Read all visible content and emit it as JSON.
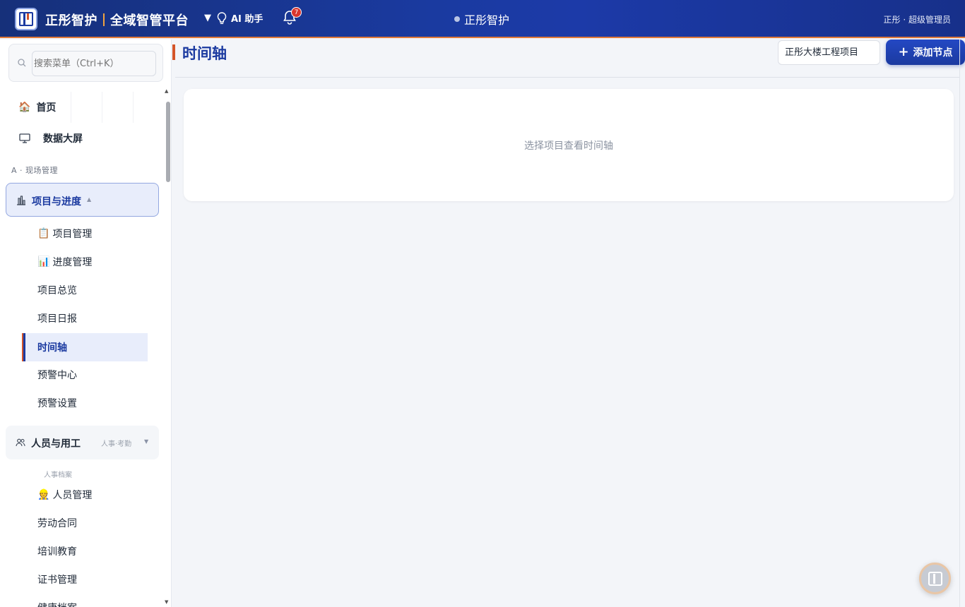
{
  "topbar": {
    "brand_name": "正彤智护",
    "platform_name": "全域智管平台",
    "caret": "▼",
    "ai_label": "AI 助手",
    "notification_count": "7",
    "center_title": "正彤智护",
    "user_label": "正彤 · 超级管理员"
  },
  "sidebar": {
    "search_placeholder": "搜索菜单（Ctrl+K）",
    "home_label": "首页",
    "screen_label": "数据大屏",
    "section_a": "A · 现场管理",
    "group_project": {
      "label": "项目与进度",
      "caret": "▲",
      "items": [
        {
          "icon": "📋",
          "label": "项目管理"
        },
        {
          "icon": "📊",
          "label": "进度管理"
        },
        {
          "icon": "",
          "label": "项目总览"
        },
        {
          "icon": "",
          "label": "项目日报"
        },
        {
          "icon": "",
          "label": "时间轴"
        },
        {
          "icon": "",
          "label": "预警中心"
        },
        {
          "icon": "",
          "label": "预警设置"
        }
      ]
    },
    "group_staff": {
      "label": "人员与用工",
      "tags": "人事·考勤",
      "caret": "▼",
      "sub_section": "人事档案",
      "items": [
        {
          "icon": "👷",
          "label": "人员管理"
        },
        {
          "icon": "",
          "label": "劳动合同"
        },
        {
          "icon": "",
          "label": "培训教育"
        },
        {
          "icon": "",
          "label": "证书管理"
        },
        {
          "icon": "",
          "label": "健康档案"
        }
      ]
    }
  },
  "main": {
    "title": "时间轴",
    "project_select_value": "正彤大楼工程项目",
    "add_button_icon": "+",
    "add_button_label": "添加节点",
    "empty_text": "选择项目查看时间轴"
  },
  "colors": {
    "brand_blue": "#1b3aa0",
    "accent_orange": "#d4552a",
    "badge_red": "#d9352e"
  }
}
